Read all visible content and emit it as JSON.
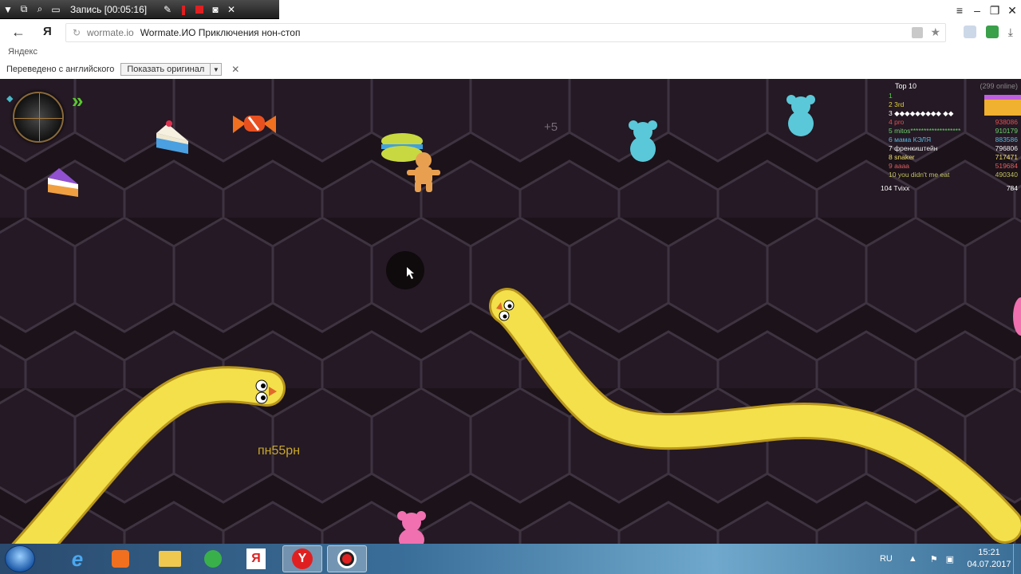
{
  "recorder": {
    "title": "Запись [00:05:16]"
  },
  "browser": {
    "domain": "wormate.io",
    "page_title": "Wormate.ИО Приключения нон-стоп",
    "bookmark": "Яндекс",
    "yandex_logo": "Я"
  },
  "translate_bar": {
    "message": "Переведено с английского",
    "show_original": "Показать оригинал"
  },
  "game": {
    "plus_score": "+5",
    "player_name": "пн55рн",
    "leaderboard": {
      "title": "Top 10",
      "online": "(299 online)",
      "rows": [
        {
          "rank": "1",
          "name": "",
          "score": "",
          "color": "#5bd04a"
        },
        {
          "rank": "2",
          "name": "3rd",
          "score": "",
          "color": "#e0d040"
        },
        {
          "rank": "3",
          "name": "◆◆◆◆◆◆◆◆◆ ◆◆",
          "score": "",
          "color": "#ffffff"
        },
        {
          "rank": "4",
          "name": "pro",
          "score": "938086",
          "color": "#e05050"
        },
        {
          "rank": "5",
          "name": "mitos*******************",
          "score": "910179",
          "color": "#6ad06a"
        },
        {
          "rank": "6",
          "name": "мама КЭЛЯ",
          "score": "883586",
          "color": "#5ab8e0"
        },
        {
          "rank": "7",
          "name": "френкиштейн",
          "score": "796806",
          "color": "#f0f0f0"
        },
        {
          "rank": "8",
          "name": "snaker",
          "score": "717471",
          "color": "#f0e060"
        },
        {
          "rank": "9",
          "name": "aaaa",
          "score": "519684",
          "color": "#e06060"
        },
        {
          "rank": "10",
          "name": "you didn't me eat",
          "score": "490340",
          "color": "#c0c060"
        }
      ],
      "me": {
        "rank": "104",
        "name": "Tvixx",
        "score": "784"
      }
    }
  },
  "taskbar": {
    "lang": "RU",
    "time": "15:21",
    "date": "04.07.2017"
  },
  "colors": {
    "worm": "#f3e04a",
    "worm_outline": "#c9a820",
    "game_bg": "#1a1118"
  }
}
